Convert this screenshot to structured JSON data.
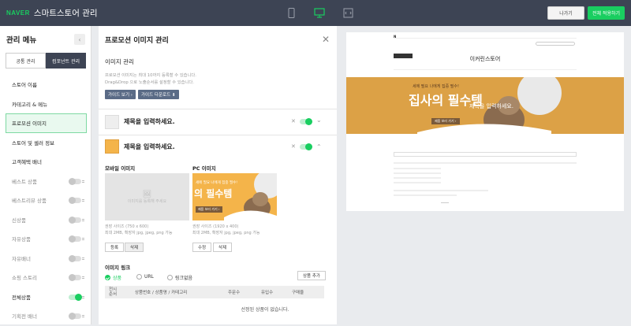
{
  "header": {
    "brand": "NAVER",
    "title": "스마트스토어 관리",
    "exit_label": "나가기",
    "apply_label": "전체 적용하기",
    "colors": {
      "bar": "#3d4454",
      "accent": "#19ce60"
    }
  },
  "sidebar": {
    "title": "관리 메뉴",
    "collapse": "‹",
    "tabs": [
      "공통 관리",
      "컴포넌트 관리"
    ],
    "items": [
      {
        "label": "스토어 이름",
        "toggle": null
      },
      {
        "label": "카테고리 & 메뉴",
        "toggle": null
      },
      {
        "label": "프로모션 이미지",
        "toggle": null,
        "selected": true
      },
      {
        "label": "스토어 및 셀러 정보",
        "toggle": null
      },
      {
        "label": "고객혜택 배너",
        "toggle": null
      },
      {
        "label": "베스트 상품",
        "toggle": "off"
      },
      {
        "label": "베스트리뷰 상품",
        "toggle": "off"
      },
      {
        "label": "신상품",
        "toggle": "off"
      },
      {
        "label": "자유상품",
        "toggle": "off"
      },
      {
        "label": "자유배너",
        "toggle": "off"
      },
      {
        "label": "쇼핑 스토리",
        "toggle": "off"
      },
      {
        "label": "전체상품",
        "toggle": "on"
      },
      {
        "label": "기획전 배너",
        "toggle": "off"
      }
    ]
  },
  "panel": {
    "title": "프로모션 이미지 관리",
    "close": "✕",
    "section": "이미지 관리",
    "desc1": "프로모션 이미지는 최대 10까지 등록할 수 있습니다.",
    "desc2": "Drag&Drop 으로 노출순서를 설정할 수 있습니다.",
    "guide_view": "가이드 보기 ›",
    "guide_download": "가이드 다운로드 ⬇",
    "item1": {
      "title": "제목을 입력하세요.",
      "remove": "✕",
      "chevron": "⌄"
    },
    "item2": {
      "title": "제목을 입력하세요.",
      "remove": "✕",
      "chevron": "⌃"
    },
    "mobile_label": "모바일 이미지",
    "pc_label": "PC 이미지",
    "mobile_placeholder": "이미지를 등록해 주세요",
    "mobile_rec1": "권장 사이즈 (750 x 600)",
    "mobile_rec2": "최대 2MB, 확장자 jpg, jpeg, png 가능",
    "pc_rec1": "권장 사이즈 (1920 x 400)",
    "pc_rec2": "최대 2MB, 확장자 jpg, jpeg, png 가능",
    "btn_register": "등록",
    "btn_delete": "삭제",
    "btn_edit": "수정",
    "btn_delete2": "삭제",
    "pc_banner_title": "의 필수템",
    "pc_banner_small": "세에 필요 나에게 집중 필수!",
    "pc_banner_chip": "제품 보러 가기 ›",
    "link_label": "이미지 링크",
    "link_options": [
      "상품",
      "URL",
      "링크없음"
    ],
    "add_product": "상품 추가",
    "table_headers": [
      "전시순서",
      "상품번호 / 상품명 / 카테고리",
      "주문수",
      "유입수",
      "구매율"
    ],
    "empty_text": "선정된 상품이 없습니다."
  },
  "preview": {
    "store_name": "이커린스토어",
    "banner_title": "집사의 필수템",
    "banner_sub": "제목을 입력하세요.",
    "banner_small": "세에 필요 나에게 집중 필수!",
    "banner_chip": "제품 보러 가기 ›"
  }
}
